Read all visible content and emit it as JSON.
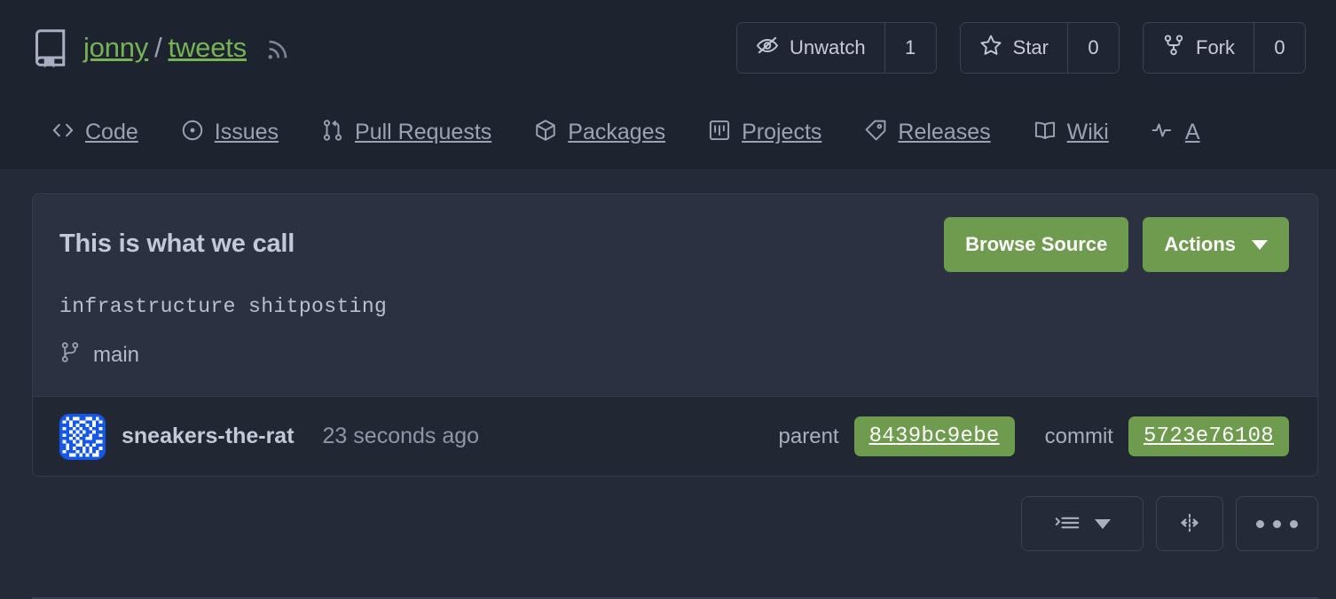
{
  "header": {
    "repo_icon": "repo-book-icon",
    "owner": "jonny",
    "separator": "/",
    "repo": "tweets",
    "rss_icon": "rss-icon",
    "actions": [
      {
        "icon": "eye-closed-icon",
        "label": "Unwatch",
        "count": "1"
      },
      {
        "icon": "star-icon",
        "label": "Star",
        "count": "0"
      },
      {
        "icon": "fork-icon",
        "label": "Fork",
        "count": "0"
      }
    ]
  },
  "nav": {
    "items": [
      {
        "icon": "code-icon",
        "label": "Code"
      },
      {
        "icon": "issue-opened-icon",
        "label": "Issues"
      },
      {
        "icon": "git-pull-request-icon",
        "label": "Pull Requests"
      },
      {
        "icon": "package-icon",
        "label": "Packages"
      },
      {
        "icon": "project-icon",
        "label": "Projects"
      },
      {
        "icon": "tag-icon",
        "label": "Releases"
      },
      {
        "icon": "book-icon",
        "label": "Wiki"
      },
      {
        "icon": "pulse-icon",
        "label": "A"
      }
    ]
  },
  "commit_card": {
    "title": "This is what we call",
    "message": "infrastructure shitposting",
    "branch_icon": "git-branch-icon",
    "branch": "main",
    "browse_source_label": "Browse Source",
    "actions_label": "Actions",
    "author": {
      "avatar_icon": "identicon-avatar",
      "name": "sneakers-the-rat",
      "time": "23 seconds ago"
    },
    "parent_label": "parent",
    "parent_hash": "8439bc9ebe",
    "commit_label": "commit",
    "commit_hash": "5723e76108"
  },
  "diff_toolbar": {
    "buttons": [
      {
        "icon": "diff-options-icon",
        "label": "",
        "has_caret": true
      },
      {
        "icon": "split-view-icon",
        "label": "",
        "has_caret": false
      },
      {
        "icon": "kebab-horizontal-icon",
        "label": "",
        "has_caret": false
      }
    ]
  },
  "colors": {
    "accent_green": "#6f9b4e",
    "link_green": "#77b255",
    "page_bg": "#252a38",
    "header_bg": "#1e2330",
    "card_bg": "#2c3142",
    "avatar_blue": "#1458e8"
  }
}
